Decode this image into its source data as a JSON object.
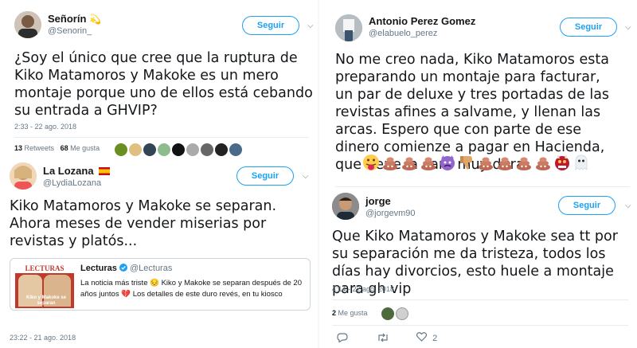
{
  "left": {
    "tweet1": {
      "name": "Señorín",
      "name_emoji": "💫",
      "handle": "@Senorin_",
      "follow": "Seguir",
      "text": "¿Soy el único que cree que la ruptura de Kiko Matamoros y Makoke es un mero montaje porque uno de ellos está cebando su entrada a GHVIP?",
      "time": "2:33 - 22 ago. 2018",
      "retweets_count": "13",
      "retweets_label": "Retweets",
      "likes_count": "68",
      "likes_label": "Me gusta"
    },
    "tweet2": {
      "name": "La Lozana",
      "handle": "@LydiaLozana",
      "follow": "Seguir",
      "text": "Kiko Matamoros y Makoke se separan. Ahora meses de vender miserias por revistas y platós...",
      "quote": {
        "name": "Lecturas",
        "handle": "@Lecturas",
        "logo": "LECTURAS",
        "cover_text": "Kiko y Makoke se separan",
        "text_line1": "La noticia más triste 😔 Kiko y Makoke se separan después de 20",
        "text_line2": "años juntos 💔 Los detalles de este duro revés, en tu kiosco"
      },
      "time": "23:22 - 21 ago. 2018"
    }
  },
  "right": {
    "tweet3": {
      "name": "Antonio Perez Gomez",
      "handle": "@elabuelo_perez",
      "follow": "Seguir",
      "text": "No me creo nada, Kiko Matamoros esta preparando un montaje para facturar, un par de deluxe y tres portadas de las revistas afines a salvame, y llenan las arcas. Espero que con parte de ese dinero comienze a pagar en Hacienda, que tiene la cara muy dura."
    },
    "tweet4": {
      "name": "jorge",
      "handle": "@jorgevm90",
      "follow": "Seguir",
      "text": "Que Kiko Matamoros y Makoke sea tt por su separación me da tristeza, todos los días hay divorcios, esto huele a montaje para gh vip",
      "time": "4:14 - 22 ago. 2018",
      "likes_count": "2",
      "likes_label": "Me gusta",
      "like_action_count": "2"
    }
  },
  "colors": {
    "accent": "#1da1f2",
    "text": "#14171a",
    "muted": "#657786",
    "border": "#e6ecf0"
  },
  "icons": [
    "chevron-down-icon",
    "verified-icon",
    "reply-icon",
    "retweet-icon",
    "heart-icon",
    "spain-flag-icon"
  ]
}
